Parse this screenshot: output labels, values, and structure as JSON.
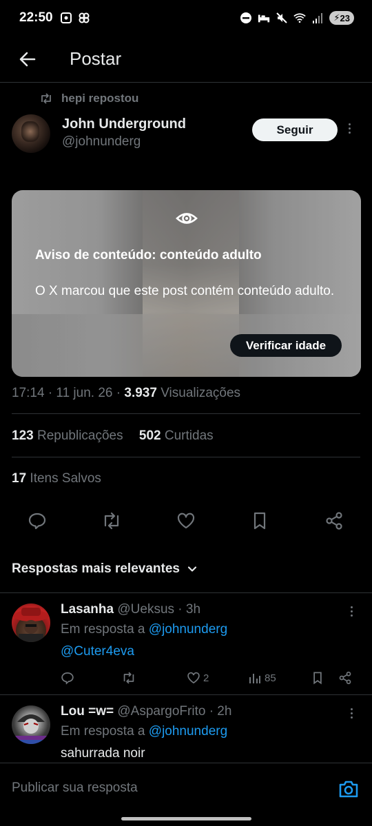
{
  "status_bar": {
    "time": "22:50",
    "battery": "23"
  },
  "header": {
    "title": "Postar"
  },
  "post": {
    "repost_text": "hepi repostou",
    "author_name": "John Underground",
    "author_handle": "@johnunderg",
    "follow_label": "Seguir",
    "warning_title": "Aviso de conteúdo: conteúdo adulto",
    "warning_body": "O X marcou que este post contém conteúdo adulto.",
    "verify_label": "Verificar idade",
    "time": "17:14 · 11 jun. 26 · ",
    "views_count": "3.937",
    "views_label": " Visualizações",
    "reposts_count": "123",
    "reposts_label": " Republicações",
    "likes_count": "502",
    "likes_label": " Curtidas",
    "saves_count": "17",
    "saves_label": " Itens Salvos"
  },
  "replies_filter": {
    "label": "Respostas mais relevantes"
  },
  "replies": [
    {
      "name": "Lasanha",
      "handle": "@Ueksus",
      "age": " · 3h",
      "reply_prefix": "Em resposta a ",
      "reply_to": "@johnunderg",
      "text": "@Cuter4eva",
      "likes": "2",
      "views": "85"
    },
    {
      "name": "Lou =w=",
      "handle": "@AspargoFrito",
      "age": " · 2h",
      "reply_prefix": "Em resposta a ",
      "reply_to": "@johnunderg",
      "text": "sahurrada noir"
    }
  ],
  "compose": {
    "placeholder": "Publicar sua resposta"
  },
  "colors": {
    "accent": "#1d9bf0",
    "muted": "#71767b",
    "text": "#e7e9ea",
    "background": "#000000"
  }
}
